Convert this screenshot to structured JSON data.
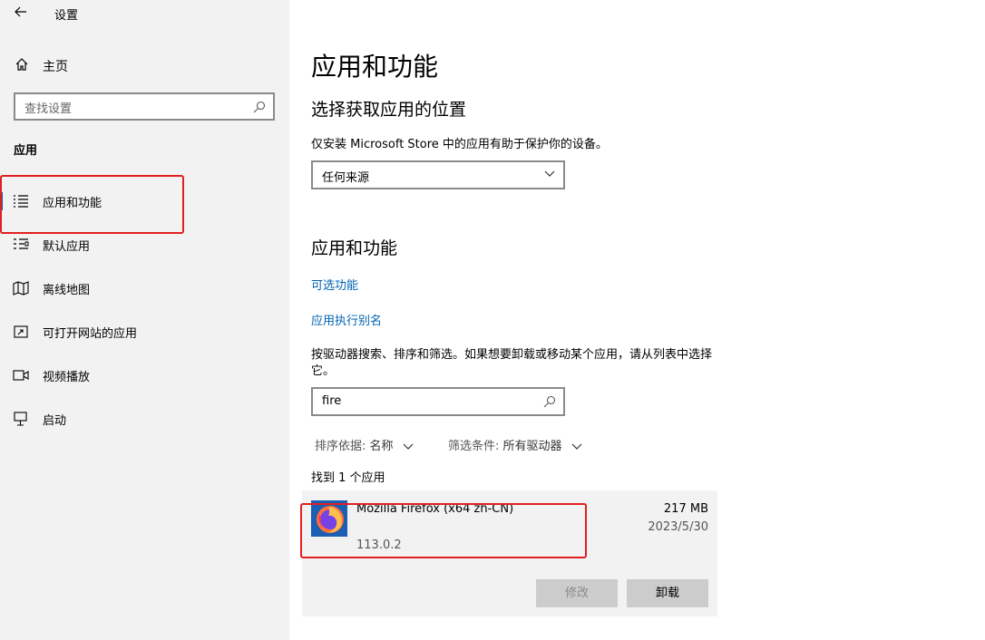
{
  "window": {
    "title": "设置"
  },
  "sidebar": {
    "home_label": "主页",
    "search_placeholder": "查找设置",
    "section_heading": "应用",
    "items": [
      {
        "label": "应用和功能",
        "icon": "apps-list-icon",
        "active": true
      },
      {
        "label": "默认应用",
        "icon": "default-apps-icon"
      },
      {
        "label": "离线地图",
        "icon": "map-icon"
      },
      {
        "label": "可打开网站的应用",
        "icon": "web-apps-icon"
      },
      {
        "label": "视频播放",
        "icon": "video-icon"
      },
      {
        "label": "启动",
        "icon": "startup-icon"
      }
    ]
  },
  "main": {
    "title": "应用和功能",
    "source_section": {
      "heading": "选择获取应用的位置",
      "description": "仅安装 Microsoft Store 中的应用有助于保护你的设备。",
      "dropdown_value": "任何来源"
    },
    "apps_section": {
      "heading": "应用和功能",
      "link_optional": "可选功能",
      "link_aliases": "应用执行别名",
      "description": "按驱动器搜索、排序和筛选。如果想要卸载或移动某个应用，请从列表中选择它。",
      "search_value": "fire",
      "sort_key": "排序依据:",
      "sort_value": "名称",
      "filter_key": "筛选条件:",
      "filter_value": "所有驱动器",
      "found_text": "找到 1 个应用"
    },
    "app": {
      "name": "Mozilla Firefox (x64 zh-CN)",
      "version": "113.0.2",
      "size": "217 MB",
      "date": "2023/5/30",
      "modify_label": "修改",
      "uninstall_label": "卸载"
    }
  },
  "colors": {
    "accent": "#0063b1",
    "highlight": "#e02020",
    "sidebar_bg": "#f2f2f2"
  }
}
